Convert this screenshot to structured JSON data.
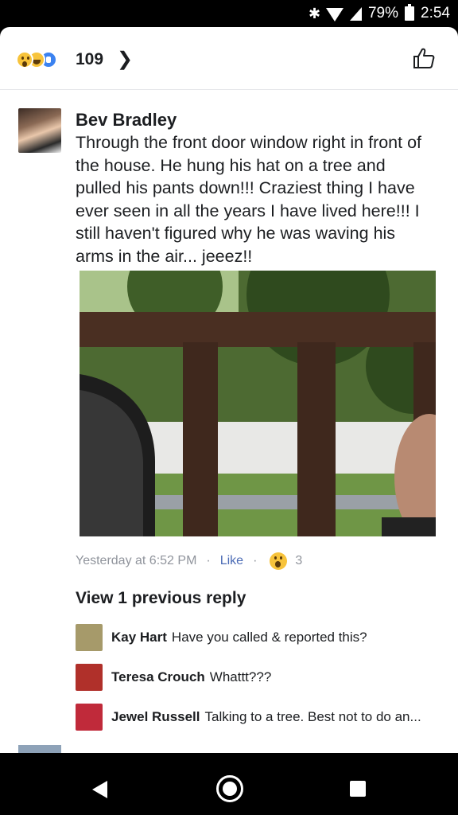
{
  "status": {
    "battery": "79%",
    "time": "2:54"
  },
  "reactions": {
    "count": "109"
  },
  "comment": {
    "author": "Bev Bradley",
    "text": "Through the front door window right in front of the house. He hung his hat on a tree and pulled his pants down!!!  Craziest thing I have ever seen in all the years I have lived here!!! I still haven't figured why he was waving his arms in the air... jeeez!!",
    "timestamp": "Yesterday at 6:52 PM",
    "like_label": "Like",
    "reaction_count": "3"
  },
  "view_previous": "View 1 previous reply",
  "replies": [
    {
      "name": "Kay Hart",
      "text": "Have you called & reported this?",
      "color": "#9a8f6e"
    },
    {
      "name": "Teresa Crouch",
      "text": "Whattt???",
      "color": "#b0302a"
    },
    {
      "name": "Jewel Russell",
      "text": "Talking to a tree.  Best not to do an...",
      "color": "#c02a3a"
    }
  ]
}
